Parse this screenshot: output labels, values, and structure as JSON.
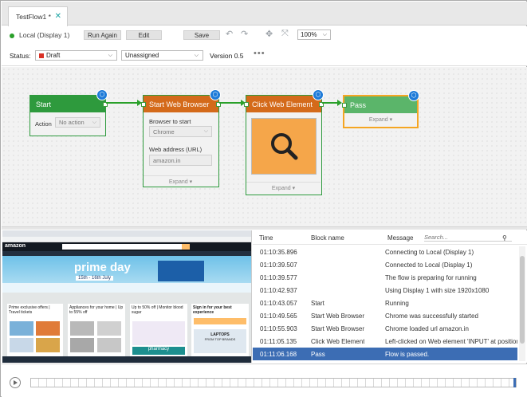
{
  "tab": {
    "title": "TestFlow1 *",
    "close": "✕"
  },
  "toolbar": {
    "connection": "Local (Display 1)",
    "run_again": "Run Again",
    "edit": "Edit",
    "save": "Save",
    "zoom": "100%",
    "icons": [
      "undo-icon",
      "redo-icon",
      "move-icon",
      "fit-icon"
    ]
  },
  "status": {
    "label": "Status:",
    "value": "Draft",
    "assignee": "Unassigned",
    "version": "Version 0.5",
    "more": "•••"
  },
  "nodes": {
    "start": {
      "title": "Start",
      "action_label": "Action",
      "action_value": "No action",
      "color": "#2e9a3d"
    },
    "browser": {
      "title": "Start Web Browser",
      "browser_label": "Browser to start",
      "browser_value": "Chrome",
      "address_label": "Web address (URL)",
      "address_value": "amazon.in",
      "expand": "Expand",
      "color": "#d46a1a"
    },
    "click": {
      "title": "Click Web Element",
      "expand": "Expand",
      "color": "#d46a1a"
    },
    "pass": {
      "title": "Pass",
      "expand": "Expand",
      "color": "#5bb56a"
    }
  },
  "screenshot": {
    "site": "amazon",
    "banner_title": "prime day",
    "banner_dates": "15th - 16th July",
    "cards": [
      {
        "title": "Prime exclusive offers | Travel tickets"
      },
      {
        "title": "Appliances for your home | Up to 55% off"
      },
      {
        "title": "Up to 50% off | Monitor blood sugar"
      },
      {
        "title": "Sign in for your best experience"
      }
    ],
    "sub_labels": {
      "pharmacy": "pharmacy",
      "laptops": "LAPTOPS",
      "laptops_sub": "FROM TOP BRANDS"
    }
  },
  "log": {
    "columns": {
      "time": "Time",
      "block": "Block name",
      "message": "Message"
    },
    "search_placeholder": "Search...",
    "rows": [
      {
        "time": "01:10:35.896",
        "block": "",
        "message": "Connecting to Local (Display 1)"
      },
      {
        "time": "01:10:39.507",
        "block": "",
        "message": "Connected to Local (Display 1)"
      },
      {
        "time": "01:10:39.577",
        "block": "",
        "message": "The flow is preparing for running"
      },
      {
        "time": "01:10:42.937",
        "block": "",
        "message": "Using Display 1 with size 1920x1080"
      },
      {
        "time": "01:10:43.057",
        "block": "Start",
        "message": "Running"
      },
      {
        "time": "01:10:49.565",
        "block": "Start Web Browser",
        "message": "Chrome was successfully started"
      },
      {
        "time": "01:10:55.903",
        "block": "Start Web Browser",
        "message": "Chrome loaded url amazon.in"
      },
      {
        "time": "01:11:05.135",
        "block": "Click Web Element",
        "message": "Left-clicked on Web element 'INPUT' at position"
      },
      {
        "time": "01:11:06.168",
        "block": "Pass",
        "message": "Flow is passed."
      }
    ],
    "selected_index": 8
  }
}
